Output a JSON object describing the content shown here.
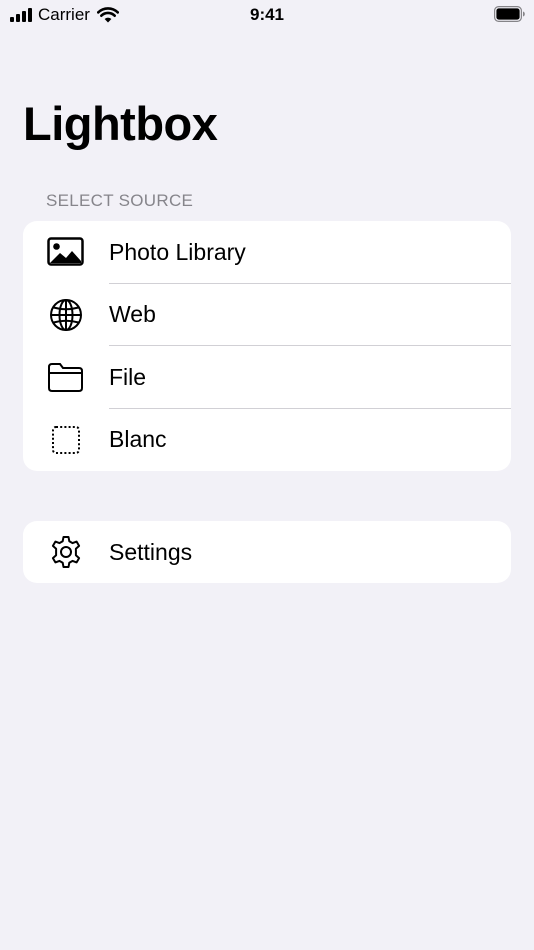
{
  "status_bar": {
    "carrier": "Carrier",
    "time": "9:41"
  },
  "title": "Lightbox",
  "sources": {
    "header": "SELECT SOURCE",
    "items": [
      {
        "label": "Photo Library",
        "icon": "photo-icon"
      },
      {
        "label": "Web",
        "icon": "globe-icon"
      },
      {
        "label": "File",
        "icon": "folder-icon"
      },
      {
        "label": "Blanc",
        "icon": "dotted-square-icon"
      }
    ]
  },
  "settings": {
    "label": "Settings",
    "icon": "gear-icon"
  },
  "colors": {
    "background": "#f2f1f7",
    "card": "#ffffff",
    "secondary_text": "#86858b",
    "separator": "#d1d0d5"
  }
}
